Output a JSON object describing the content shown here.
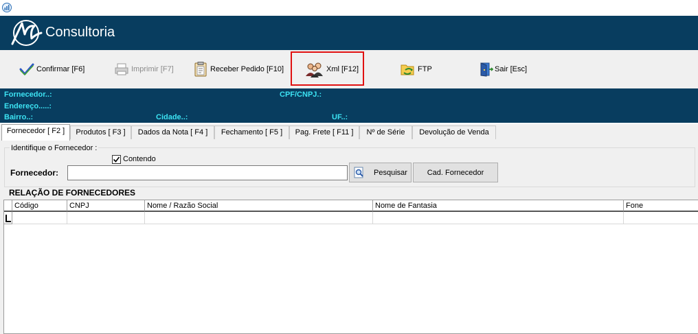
{
  "app": {
    "brand": "Consultoria",
    "window_icon": "bar-chart-icon"
  },
  "toolbar": {
    "confirmar": "Confirmar [F6]",
    "imprimir": "Imprimir  [F7]",
    "receber_pedido": "Receber Pedido [F10]",
    "xml": "Xml [F12]",
    "ftp": "FTP",
    "sair": "Sair [Esc]"
  },
  "info": {
    "fornecedor": "Fornecedor..:",
    "cpf_cnpj": "CPF/CNPJ.:",
    "endereco": "Endereço.....:",
    "bairro": "Bairro..:",
    "cidade": "Cidade..:",
    "uf": "UF..:"
  },
  "tabs": [
    {
      "label": "Fornecedor [ F2 ]",
      "active": true
    },
    {
      "label": "Produtos [ F3 ]"
    },
    {
      "label": "Dados da Nota [ F4 ]"
    },
    {
      "label": "Fechamento [ F5 ]"
    },
    {
      "label": "Pag. Frete [ F11 ]"
    },
    {
      "label": "Nº de Série"
    },
    {
      "label": "Devolução de Venda"
    }
  ],
  "fornecedor_panel": {
    "group_title": "Identifique o Fornecedor :",
    "contendo_label": "Contendo",
    "contendo_checked": true,
    "fornecedor_label": "Fornecedor:",
    "fornecedor_value": "",
    "pesquisar_label": "Pesquisar",
    "cad_fornecedor_label": "Cad. Fornecedor",
    "relacao_title": "RELAÇÃO DE FORNECEDORES"
  },
  "grid": {
    "columns": [
      "Código",
      "CNPJ",
      "Nome / Razão Social",
      "Nome de Fantasia",
      "Fone"
    ],
    "rows": []
  },
  "colors": {
    "header_bg": "#083d5f",
    "info_label": "#3ce3f3",
    "highlight": "#e01010"
  }
}
